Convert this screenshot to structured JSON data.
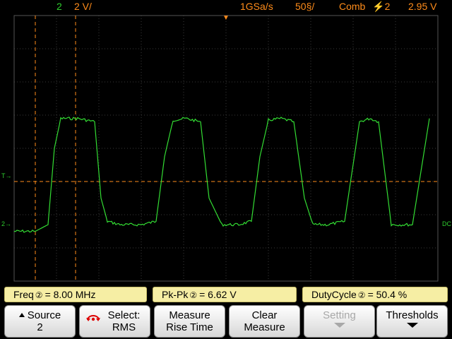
{
  "status": {
    "channel": "2",
    "vertical_scale": "2 V/",
    "sample_rate": "1GSa/s",
    "timebase": "50§/",
    "trigger_mode": "Comb",
    "trigger_source": "⚡2",
    "trigger_level": "2.95 V"
  },
  "markers": {
    "trigger_level_left": "T→",
    "channel_ground": "2→",
    "dc_label": "DC"
  },
  "measurements": [
    {
      "label": "Freq",
      "channel": "②",
      "value": "= 8.00 MHz"
    },
    {
      "label": "Pk-Pk",
      "channel": "②",
      "value": "= 6.62 V"
    },
    {
      "label": "DutyCycle",
      "channel": "②",
      "value": "= 50.4 %"
    }
  ],
  "softkeys": [
    {
      "line1": "Source",
      "line2": "2",
      "enabled": true
    },
    {
      "line1": "Select:",
      "line2": "RMS",
      "enabled": true
    },
    {
      "line1": "Measure",
      "line2": "Rise Time",
      "enabled": true
    },
    {
      "line1": "Clear",
      "line2": "Measure",
      "enabled": true
    },
    {
      "line1": "Setting",
      "line2": "",
      "enabled": false
    },
    {
      "line1": "Thresholds",
      "line2": "",
      "enabled": true
    }
  ],
  "colors": {
    "trace": "#33dd33",
    "cursor": "#ff8c1a",
    "grid": "#3a3a3a",
    "measure_bg": "#f6eea4"
  },
  "chart_data": {
    "type": "line",
    "series": [
      {
        "name": "2",
        "x_divisions": [
          0.0,
          0.5,
          0.8,
          0.95,
          1.1,
          1.5,
          1.9,
          2.05,
          2.2,
          2.5,
          3.0,
          3.35,
          3.55,
          3.75,
          4.05,
          4.4,
          4.6,
          4.9,
          5.3,
          5.6,
          5.8,
          6.0,
          6.3,
          6.6,
          6.85,
          7.05,
          7.4,
          7.8,
          8.15,
          8.4,
          8.6,
          8.9,
          9.4,
          9.8
        ],
        "y_volts": [
          -5.0,
          -5.0,
          -4.6,
          0.0,
          1.8,
          1.8,
          1.6,
          -3.0,
          -4.4,
          -4.6,
          -4.6,
          -4.4,
          -0.5,
          1.7,
          1.8,
          1.6,
          -3.0,
          -4.6,
          -4.6,
          -4.4,
          -0.5,
          1.7,
          1.8,
          1.6,
          -3.0,
          -4.6,
          -4.6,
          -4.4,
          1.6,
          1.8,
          1.6,
          -4.6,
          -4.6,
          1.8
        ]
      }
    ],
    "trigger_level_volts": -2.0,
    "cursor_x_divisions": [
      0.5,
      1.45
    ]
  }
}
